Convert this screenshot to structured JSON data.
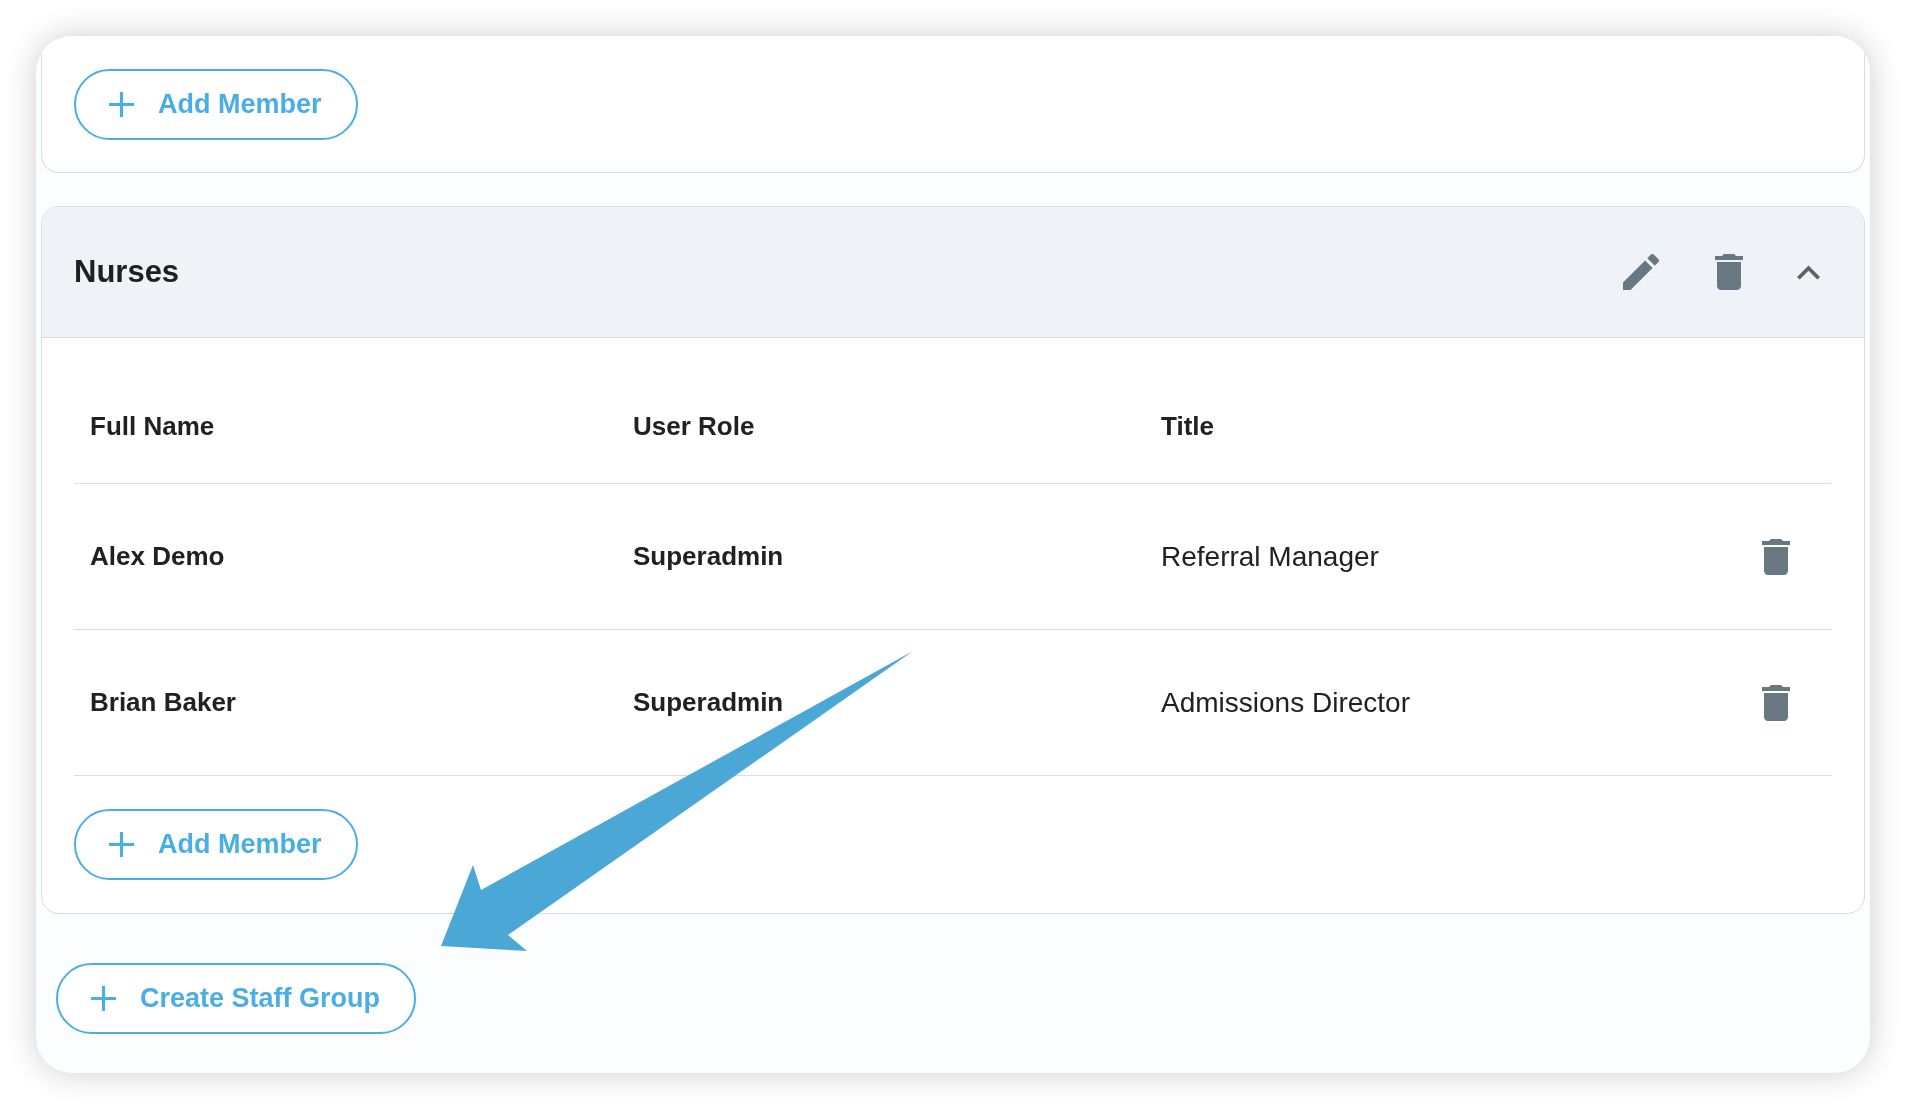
{
  "top_group": {
    "add_member_button": {
      "label": "Add Member"
    }
  },
  "group": {
    "title": "Nurses",
    "expanded": true,
    "table": {
      "columns": [
        "Full Name",
        "User Role",
        "Title"
      ],
      "rows": [
        {
          "full_name": "Alex Demo",
          "user_role": "Superadmin",
          "title": "Referral Manager"
        },
        {
          "full_name": "Brian Baker",
          "user_role": "Superadmin",
          "title": "Admissions Director"
        }
      ]
    },
    "add_member_button": {
      "label": "Add Member"
    }
  },
  "create_group_button": {
    "label": "Create Staff Group"
  }
}
